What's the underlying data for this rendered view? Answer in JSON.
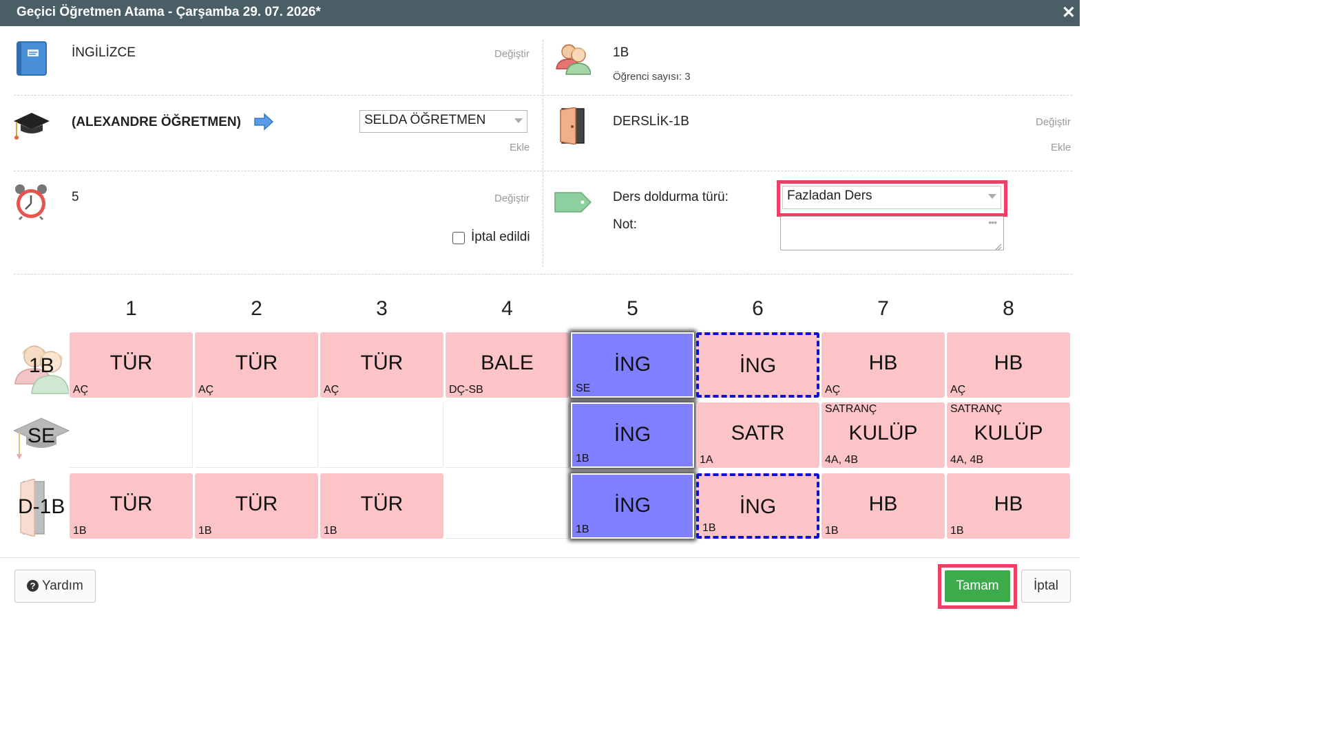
{
  "window": {
    "title": "Geçici Öğretmen Atama - Çarşamba 29. 07. 2026*",
    "close_icon": "close-icon"
  },
  "subject": {
    "icon": "book-icon",
    "name": "İNGİLİZCE",
    "change_label": "Değiştir"
  },
  "class": {
    "icon": "students-icon",
    "name": "1B",
    "student_count": "Öğrenci sayısı: 3"
  },
  "teacher": {
    "icon": "graduation-cap-icon",
    "original": "(ALEXANDRE ÖĞRETMEN)",
    "arrow_icon": "arrow-right-icon",
    "replacement_value": "SELDA ÖĞRETMEN",
    "add_label": "Ekle"
  },
  "classroom": {
    "icon": "door-icon",
    "name": "DERSLİK-1B",
    "change_label": "Değiştir",
    "add_label": "Ekle"
  },
  "period": {
    "icon": "alarm-clock-icon",
    "value": "5",
    "change_label": "Değiştir",
    "cancelled_label": "İptal edildi",
    "cancelled": false
  },
  "fill": {
    "icon": "tag-icon",
    "type_label": "Ders doldurma türü:",
    "type_value": "Fazladan Ders",
    "note_label": "Not:",
    "note_value": "",
    "highlight_color": "#ee3f67"
  },
  "timetable": {
    "periods": [
      "1",
      "2",
      "3",
      "4",
      "5",
      "6",
      "7",
      "8"
    ],
    "rows": [
      {
        "label": "1B",
        "icon": "students-icon",
        "cells": [
          {
            "main": "TÜR",
            "sub": "AÇ",
            "top": "",
            "state": "lesson"
          },
          {
            "main": "TÜR",
            "sub": "AÇ",
            "top": "",
            "state": "lesson"
          },
          {
            "main": "TÜR",
            "sub": "AÇ",
            "top": "",
            "state": "lesson"
          },
          {
            "main": "BALE",
            "sub": "DÇ-SB",
            "top": "",
            "state": "lesson"
          },
          {
            "main": "İNG",
            "sub": "SE",
            "top": "",
            "state": "active"
          },
          {
            "main": "İNG",
            "sub": "",
            "top": "",
            "state": "target"
          },
          {
            "main": "HB",
            "sub": "AÇ",
            "top": "",
            "state": "lesson"
          },
          {
            "main": "HB",
            "sub": "AÇ",
            "top": "",
            "state": "lesson"
          }
        ]
      },
      {
        "label": "SE",
        "icon": "graduation-cap-icon",
        "cells": [
          {
            "main": "",
            "sub": "",
            "top": "",
            "state": "empty"
          },
          {
            "main": "",
            "sub": "",
            "top": "",
            "state": "empty"
          },
          {
            "main": "",
            "sub": "",
            "top": "",
            "state": "empty"
          },
          {
            "main": "",
            "sub": "",
            "top": "",
            "state": "empty"
          },
          {
            "main": "İNG",
            "sub": "1B",
            "top": "",
            "state": "active"
          },
          {
            "main": "SATR",
            "sub": "1A",
            "top": "",
            "state": "lesson"
          },
          {
            "main": "KULÜP",
            "sub": "4A, 4B",
            "top": "SATRANÇ",
            "state": "lesson"
          },
          {
            "main": "KULÜP",
            "sub": "4A, 4B",
            "top": "SATRANÇ",
            "state": "lesson"
          }
        ]
      },
      {
        "label": "D-1B",
        "icon": "door-icon",
        "cells": [
          {
            "main": "TÜR",
            "sub": "1B",
            "top": "",
            "state": "lesson"
          },
          {
            "main": "TÜR",
            "sub": "1B",
            "top": "",
            "state": "lesson"
          },
          {
            "main": "TÜR",
            "sub": "1B",
            "top": "",
            "state": "lesson"
          },
          {
            "main": "",
            "sub": "",
            "top": "",
            "state": "empty"
          },
          {
            "main": "İNG",
            "sub": "1B",
            "top": "",
            "state": "active"
          },
          {
            "main": "İNG",
            "sub": "1B",
            "top": "",
            "state": "target"
          },
          {
            "main": "HB",
            "sub": "1B",
            "top": "",
            "state": "lesson"
          },
          {
            "main": "HB",
            "sub": "1B",
            "top": "",
            "state": "lesson"
          }
        ]
      }
    ]
  },
  "footer": {
    "help_icon": "question-circle-icon",
    "help_label": "Yardım",
    "ok_label": "Tamam",
    "cancel_label": "İptal"
  }
}
